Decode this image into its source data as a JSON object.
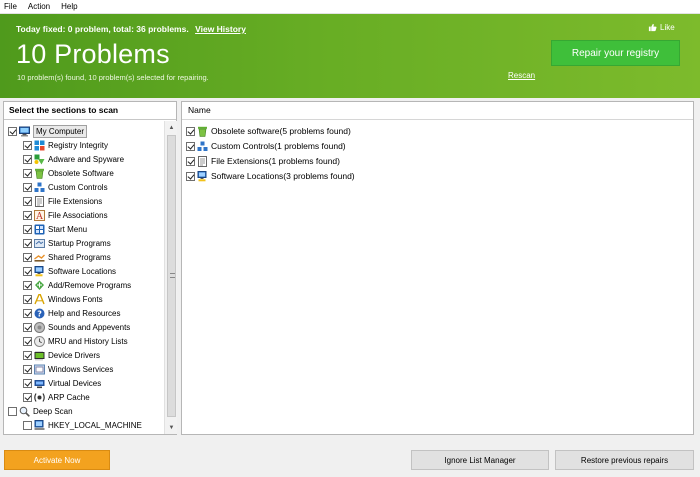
{
  "menu": [
    "File",
    "Action",
    "Help"
  ],
  "banner": {
    "status_text": "Today fixed: 0 problem, total: 36 problems.",
    "view_history": "View History",
    "title": "10 Problems",
    "subtitle": "10 problem(s) found, 10 problem(s) selected for repairing.",
    "rescan": "Rescan",
    "like": "Like",
    "repair_button": "Repair your registry",
    "colors": {
      "green_start": "#4f9a1c",
      "green_end": "#7dbb2c",
      "repair_button": "#3fbf3a"
    }
  },
  "left_panel": {
    "header": "Select the sections to scan",
    "tree": [
      {
        "label": "My Computer",
        "checked": true,
        "icon": "computer-icon",
        "level": 0
      },
      {
        "label": "Registry Integrity",
        "checked": true,
        "icon": "registry-icon",
        "level": 1
      },
      {
        "label": "Adware and Spyware",
        "checked": true,
        "icon": "spyware-icon",
        "level": 1
      },
      {
        "label": "Obsolete Software",
        "checked": true,
        "icon": "recycle-bin-icon",
        "level": 1
      },
      {
        "label": "Custom Controls",
        "checked": true,
        "icon": "controls-icon",
        "level": 1
      },
      {
        "label": "File Extensions",
        "checked": true,
        "icon": "document-icon",
        "level": 1
      },
      {
        "label": "File Associations",
        "checked": true,
        "icon": "font-a-icon",
        "level": 1
      },
      {
        "label": "Start Menu",
        "checked": true,
        "icon": "start-menu-icon",
        "level": 1
      },
      {
        "label": "Startup Programs",
        "checked": true,
        "icon": "startup-icon",
        "level": 1
      },
      {
        "label": "Shared Programs",
        "checked": true,
        "icon": "shared-icon",
        "level": 1
      },
      {
        "label": "Software Locations",
        "checked": true,
        "icon": "software-locations-icon",
        "level": 1
      },
      {
        "label": "Add/Remove Programs",
        "checked": true,
        "icon": "add-remove-icon",
        "level": 1
      },
      {
        "label": "Windows Fonts",
        "checked": true,
        "icon": "fonts-icon",
        "level": 1
      },
      {
        "label": "Help and Resources",
        "checked": true,
        "icon": "help-icon",
        "level": 1
      },
      {
        "label": "Sounds and Appevents",
        "checked": true,
        "icon": "sound-icon",
        "level": 1
      },
      {
        "label": "MRU and History Lists",
        "checked": true,
        "icon": "history-icon",
        "level": 1
      },
      {
        "label": "Device Drivers",
        "checked": true,
        "icon": "driver-icon",
        "level": 1
      },
      {
        "label": "Windows Services",
        "checked": true,
        "icon": "services-icon",
        "level": 1
      },
      {
        "label": "Virtual Devices",
        "checked": true,
        "icon": "virtual-devices-icon",
        "level": 1
      },
      {
        "label": "ARP Cache",
        "checked": true,
        "icon": "arp-cache-icon",
        "level": 1
      },
      {
        "label": "Deep Scan",
        "checked": false,
        "icon": "magnifier-icon",
        "level": 0
      },
      {
        "label": "HKEY_LOCAL_MACHINE",
        "checked": false,
        "icon": "registry-hive-icon",
        "level": 1
      }
    ]
  },
  "right_panel": {
    "column_header": "Name",
    "rows": [
      {
        "label": "Obsolete software(5 problems found)",
        "checked": true,
        "icon": "recycle-bin-icon"
      },
      {
        "label": "Custom Controls(1 problems found)",
        "checked": true,
        "icon": "controls-icon"
      },
      {
        "label": "File Extensions(1 problems found)",
        "checked": true,
        "icon": "document-icon"
      },
      {
        "label": "Software Locations(3 problems found)",
        "checked": true,
        "icon": "software-locations-icon"
      }
    ]
  },
  "bottom": {
    "activate": "Activate Now",
    "ignore_list": "Ignore List Manager",
    "restore": "Restore previous repairs",
    "colors": {
      "activate": "#f3a21f"
    }
  }
}
